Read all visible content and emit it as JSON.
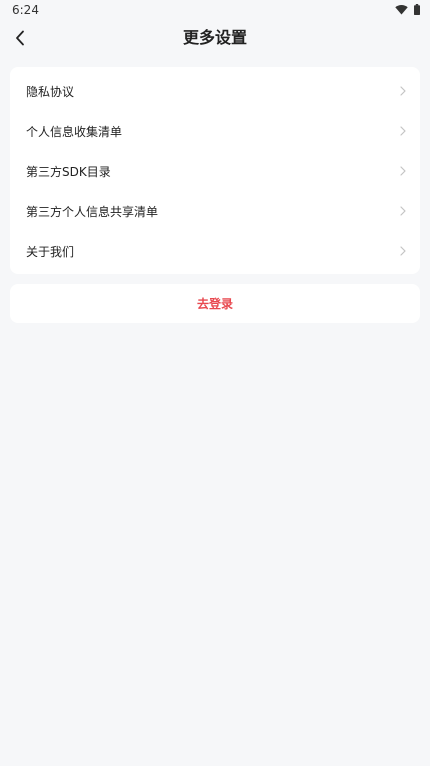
{
  "status_bar": {
    "time": "6:24",
    "icons": [
      "wifi-icon",
      "battery-icon"
    ]
  },
  "header": {
    "title": "更多设置",
    "back_icon": "chevron-left-icon"
  },
  "menu": {
    "items": [
      {
        "label": "隐私协议"
      },
      {
        "label": "个人信息收集清单"
      },
      {
        "label": "第三方SDK目录"
      },
      {
        "label": "第三方个人信息共享清单"
      },
      {
        "label": "关于我们"
      }
    ],
    "chevron_icon": "chevron-right-icon"
  },
  "logout": {
    "label": "去登录"
  },
  "colors": {
    "background": "#f6f7f9",
    "card": "#ffffff",
    "text": "#222222",
    "chevron": "#c4c4c4",
    "accent_red": "#e8484f"
  }
}
